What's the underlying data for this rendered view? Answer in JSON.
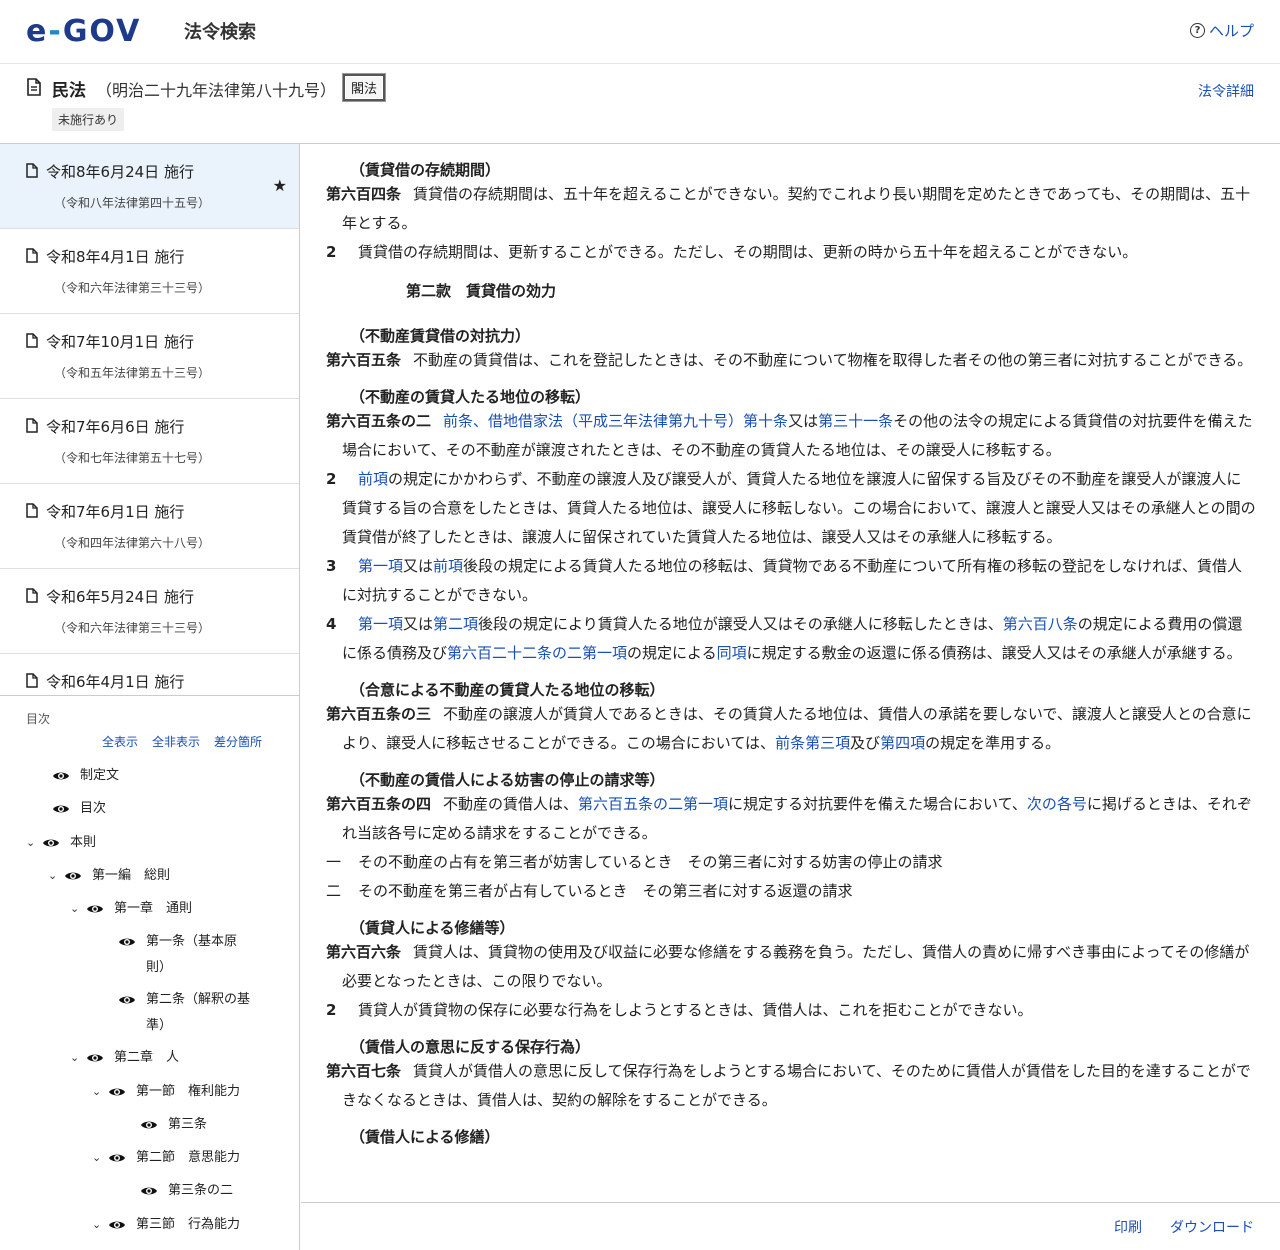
{
  "header": {
    "logo_text_e": "e",
    "logo_text_dash": "-",
    "logo_text_gov": "GOV",
    "site_name": "法令検索",
    "help_label": "ヘルプ"
  },
  "law": {
    "name": "民法",
    "number": "（明治二十九年法律第八十九号）",
    "kaku_button": "閣法",
    "badge": "未施行あり",
    "detail_link": "法令詳細"
  },
  "versions": [
    {
      "date": "令和8年6月24日 施行",
      "num": "（令和八年法律第四十五号）",
      "selected": true
    },
    {
      "date": "令和8年4月1日 施行",
      "num": "（令和六年法律第三十三号）"
    },
    {
      "date": "令和7年10月1日 施行",
      "num": "（令和五年法律第五十三号）"
    },
    {
      "date": "令和7年6月6日 施行",
      "num": "（令和七年法律第五十七号）"
    },
    {
      "date": "令和7年6月1日 施行",
      "num": "（令和四年法律第六十八号）"
    },
    {
      "date": "令和6年5月24日 施行",
      "num": "（令和六年法律第三十三号）"
    },
    {
      "date": "令和6年4月1日 施行",
      "num": ""
    }
  ],
  "toc": {
    "label": "目次",
    "show_all": "全表示",
    "hide_all": "全非表示",
    "diff": "差分箇所",
    "items": [
      {
        "label": "制定文"
      },
      {
        "label": "目次"
      },
      {
        "label": "本則"
      },
      {
        "label": "第一編　総則"
      },
      {
        "label": "第一章　通則"
      },
      {
        "label": "第一条（基本原",
        "label2": "則）"
      },
      {
        "label": "第二条（解釈の基",
        "label2": "準）"
      },
      {
        "label": "第二章　人"
      },
      {
        "label": "第一節　権利能力"
      },
      {
        "label": "第三条"
      },
      {
        "label": "第二節　意思能力"
      },
      {
        "label": "第三条の二"
      },
      {
        "label": "第三節　行為能力"
      }
    ]
  },
  "content": {
    "a604_cap": "（賃貸借の存続期間）",
    "a604_no": "第六百四条",
    "a604_text": "賃貸借の存続期間は、五十年を超えることができない。契約でこれより長い期間を定めたときであっても、その期間は、五十年とする。",
    "a604_p2": "賃貸借の存続期間は、更新することができる。ただし、その期間は、更新の時から五十年を超えることができない。",
    "sec2": "第二款　賃貸借の効力",
    "a605_cap": "（不動産賃貸借の対抗力）",
    "a605_no": "第六百五条",
    "a605_text": "不動産の賃貸借は、これを登記したときは、その不動産について物権を取得した者その他の第三者に対抗することができる。",
    "a605_2_cap": "（不動産の賃貸人たる地位の移転）",
    "a605_2_no": "第六百五条の二",
    "a605_2_link1": "前条",
    "a605_2_t1": "、",
    "a605_2_link2": "借地借家法（平成三年法律第九十号）第十条",
    "a605_2_t2": "又は",
    "a605_2_link3": "第三十一条",
    "a605_2_t3": "その他の法令の規定による賃貸借の対抗要件を備えた場合において、その不動産が譲渡されたときは、その不動産の賃貸人たる地位は、その譲受人に移転する。",
    "a605_2_p2_link": "前項",
    "a605_2_p2_text": "の規定にかかわらず、不動産の譲渡人及び譲受人が、賃貸人たる地位を譲渡人に留保する旨及びその不動産を譲受人が譲渡人に賃貸する旨の合意をしたときは、賃貸人たる地位は、譲受人に移転しない。この場合において、譲渡人と譲受人又はその承継人との間の賃貸借が終了したときは、譲渡人に留保されていた賃貸人たる地位は、譲受人又はその承継人に移転する。",
    "a605_2_p3_link1": "第一項",
    "a605_2_p3_t1": "又は",
    "a605_2_p3_link2": "前項",
    "a605_2_p3_t2": "後段の規定による賃貸人たる地位の移転は、賃貸物である不動産について所有権の移転の登記をしなければ、賃借人に対抗することができない。",
    "a605_2_p4_link1": "第一項",
    "a605_2_p4_t1": "又は",
    "a605_2_p4_link2": "第二項",
    "a605_2_p4_t2": "後段の規定により賃貸人たる地位が譲受人又はその承継人に移転したときは、",
    "a605_2_p4_link3": "第六百八条",
    "a605_2_p4_t3": "の規定による費用の償還に係る債務及び",
    "a605_2_p4_link4": "第六百二十二条の二第一項",
    "a605_2_p4_t4": "の規定による",
    "a605_2_p4_link5": "同項",
    "a605_2_p4_t5": "に規定する敷金の返還に係る債務は、譲受人又はその承継人が承継する。",
    "a605_3_cap": "（合意による不動産の賃貸人たる地位の移転）",
    "a605_3_no": "第六百五条の三",
    "a605_3_t1": "不動産の譲渡人が賃貸人であるときは、その賃貸人たる地位は、賃借人の承諾を要しないで、譲渡人と譲受人との合意により、譲受人に移転させることができる。この場合においては、",
    "a605_3_link1": "前条第三項",
    "a605_3_t2": "及び",
    "a605_3_link2": "第四項",
    "a605_3_t3": "の規定を準用する。",
    "a605_4_cap": "（不動産の賃借人による妨害の停止の請求等）",
    "a605_4_no": "第六百五条の四",
    "a605_4_t1": "不動産の賃借人は、",
    "a605_4_link1": "第六百五条の二第一項",
    "a605_4_t2": "に規定する対抗要件を備えた場合において、",
    "a605_4_link2": "次の各号",
    "a605_4_t3": "に掲げるときは、それぞれ当該各号に定める請求をすることができる。",
    "a605_4_i1_no": "一",
    "a605_4_i1": "その不動産の占有を第三者が妨害しているとき　その第三者に対する妨害の停止の請求",
    "a605_4_i2_no": "二",
    "a605_4_i2": "その不動産を第三者が占有しているとき　その第三者に対する返還の請求",
    "a606_cap": "（賃貸人による修繕等）",
    "a606_no": "第六百六条",
    "a606_text": "賃貸人は、賃貸物の使用及び収益に必要な修繕をする義務を負う。ただし、賃借人の責めに帰すべき事由によってその修繕が必要となったときは、この限りでない。",
    "a606_p2": "賃貸人が賃貸物の保存に必要な行為をしようとするときは、賃借人は、これを拒むことができない。",
    "a607_cap": "（賃借人の意思に反する保存行為）",
    "a607_no": "第六百七条",
    "a607_text": "賃貸人が賃借人の意思に反して保存行為をしようとする場合において、そのために賃借人が賃借をした目的を達することができなくなるときは、賃借人は、契約の解除をすることができる。",
    "a607_2_cap": "（賃借人による修繕）",
    "p2": "2",
    "p3": "3",
    "p4": "4"
  },
  "footer": {
    "print": "印刷",
    "download": "ダウンロード"
  }
}
